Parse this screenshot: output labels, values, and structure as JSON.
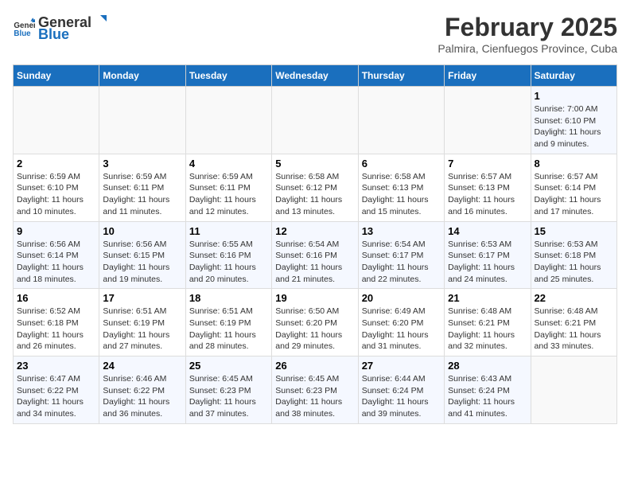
{
  "app": {
    "name_general": "General",
    "name_blue": "Blue"
  },
  "header": {
    "title": "February 2025",
    "subtitle": "Palmira, Cienfuegos Province, Cuba"
  },
  "calendar": {
    "days_of_week": [
      "Sunday",
      "Monday",
      "Tuesday",
      "Wednesday",
      "Thursday",
      "Friday",
      "Saturday"
    ],
    "weeks": [
      [
        {
          "day": "",
          "info": ""
        },
        {
          "day": "",
          "info": ""
        },
        {
          "day": "",
          "info": ""
        },
        {
          "day": "",
          "info": ""
        },
        {
          "day": "",
          "info": ""
        },
        {
          "day": "",
          "info": ""
        },
        {
          "day": "1",
          "info": "Sunrise: 7:00 AM\nSunset: 6:10 PM\nDaylight: 11 hours\nand 9 minutes."
        }
      ],
      [
        {
          "day": "2",
          "info": "Sunrise: 6:59 AM\nSunset: 6:10 PM\nDaylight: 11 hours\nand 10 minutes."
        },
        {
          "day": "3",
          "info": "Sunrise: 6:59 AM\nSunset: 6:11 PM\nDaylight: 11 hours\nand 11 minutes."
        },
        {
          "day": "4",
          "info": "Sunrise: 6:59 AM\nSunset: 6:11 PM\nDaylight: 11 hours\nand 12 minutes."
        },
        {
          "day": "5",
          "info": "Sunrise: 6:58 AM\nSunset: 6:12 PM\nDaylight: 11 hours\nand 13 minutes."
        },
        {
          "day": "6",
          "info": "Sunrise: 6:58 AM\nSunset: 6:13 PM\nDaylight: 11 hours\nand 15 minutes."
        },
        {
          "day": "7",
          "info": "Sunrise: 6:57 AM\nSunset: 6:13 PM\nDaylight: 11 hours\nand 16 minutes."
        },
        {
          "day": "8",
          "info": "Sunrise: 6:57 AM\nSunset: 6:14 PM\nDaylight: 11 hours\nand 17 minutes."
        }
      ],
      [
        {
          "day": "9",
          "info": "Sunrise: 6:56 AM\nSunset: 6:14 PM\nDaylight: 11 hours\nand 18 minutes."
        },
        {
          "day": "10",
          "info": "Sunrise: 6:56 AM\nSunset: 6:15 PM\nDaylight: 11 hours\nand 19 minutes."
        },
        {
          "day": "11",
          "info": "Sunrise: 6:55 AM\nSunset: 6:16 PM\nDaylight: 11 hours\nand 20 minutes."
        },
        {
          "day": "12",
          "info": "Sunrise: 6:54 AM\nSunset: 6:16 PM\nDaylight: 11 hours\nand 21 minutes."
        },
        {
          "day": "13",
          "info": "Sunrise: 6:54 AM\nSunset: 6:17 PM\nDaylight: 11 hours\nand 22 minutes."
        },
        {
          "day": "14",
          "info": "Sunrise: 6:53 AM\nSunset: 6:17 PM\nDaylight: 11 hours\nand 24 minutes."
        },
        {
          "day": "15",
          "info": "Sunrise: 6:53 AM\nSunset: 6:18 PM\nDaylight: 11 hours\nand 25 minutes."
        }
      ],
      [
        {
          "day": "16",
          "info": "Sunrise: 6:52 AM\nSunset: 6:18 PM\nDaylight: 11 hours\nand 26 minutes."
        },
        {
          "day": "17",
          "info": "Sunrise: 6:51 AM\nSunset: 6:19 PM\nDaylight: 11 hours\nand 27 minutes."
        },
        {
          "day": "18",
          "info": "Sunrise: 6:51 AM\nSunset: 6:19 PM\nDaylight: 11 hours\nand 28 minutes."
        },
        {
          "day": "19",
          "info": "Sunrise: 6:50 AM\nSunset: 6:20 PM\nDaylight: 11 hours\nand 29 minutes."
        },
        {
          "day": "20",
          "info": "Sunrise: 6:49 AM\nSunset: 6:20 PM\nDaylight: 11 hours\nand 31 minutes."
        },
        {
          "day": "21",
          "info": "Sunrise: 6:48 AM\nSunset: 6:21 PM\nDaylight: 11 hours\nand 32 minutes."
        },
        {
          "day": "22",
          "info": "Sunrise: 6:48 AM\nSunset: 6:21 PM\nDaylight: 11 hours\nand 33 minutes."
        }
      ],
      [
        {
          "day": "23",
          "info": "Sunrise: 6:47 AM\nSunset: 6:22 PM\nDaylight: 11 hours\nand 34 minutes."
        },
        {
          "day": "24",
          "info": "Sunrise: 6:46 AM\nSunset: 6:22 PM\nDaylight: 11 hours\nand 36 minutes."
        },
        {
          "day": "25",
          "info": "Sunrise: 6:45 AM\nSunset: 6:23 PM\nDaylight: 11 hours\nand 37 minutes."
        },
        {
          "day": "26",
          "info": "Sunrise: 6:45 AM\nSunset: 6:23 PM\nDaylight: 11 hours\nand 38 minutes."
        },
        {
          "day": "27",
          "info": "Sunrise: 6:44 AM\nSunset: 6:24 PM\nDaylight: 11 hours\nand 39 minutes."
        },
        {
          "day": "28",
          "info": "Sunrise: 6:43 AM\nSunset: 6:24 PM\nDaylight: 11 hours\nand 41 minutes."
        },
        {
          "day": "",
          "info": ""
        }
      ]
    ]
  }
}
